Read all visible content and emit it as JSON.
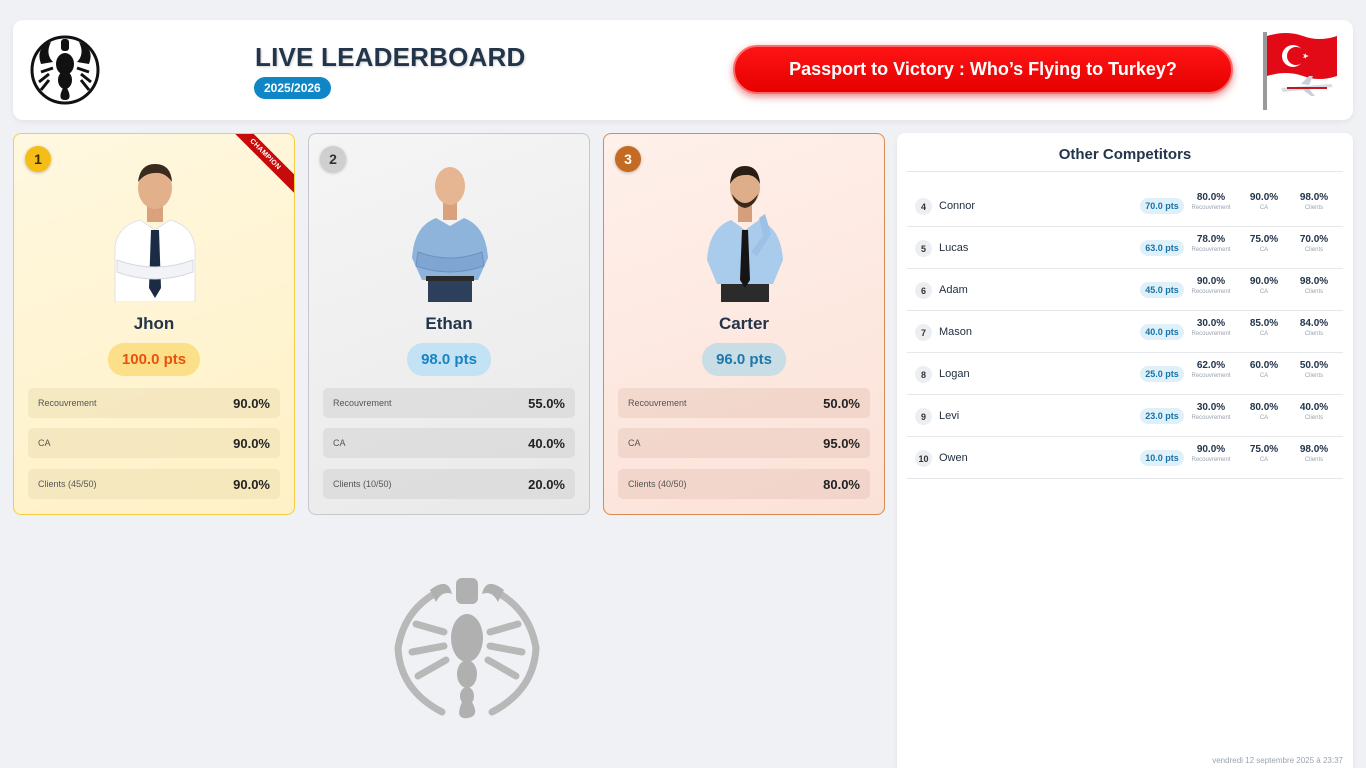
{
  "header": {
    "title": "LIVE LEADERBOARD",
    "season": "2025/2026",
    "promo": "Passport to Victory : Who’s Flying to Turkey?"
  },
  "podium": [
    {
      "rank": "1",
      "name": "Jhon",
      "points": "100.0 pts",
      "ribbon": "CHAMPION",
      "metrics": [
        {
          "label": "Recouvrement",
          "value": "90.0%"
        },
        {
          "label": "CA",
          "value": "90.0%"
        },
        {
          "label": "Clients (45/50)",
          "value": "90.0%"
        }
      ]
    },
    {
      "rank": "2",
      "name": "Ethan",
      "points": "98.0 pts",
      "metrics": [
        {
          "label": "Recouvrement",
          "value": "55.0%"
        },
        {
          "label": "CA",
          "value": "40.0%"
        },
        {
          "label": "Clients (10/50)",
          "value": "20.0%"
        }
      ]
    },
    {
      "rank": "3",
      "name": "Carter",
      "points": "96.0 pts",
      "metrics": [
        {
          "label": "Recouvrement",
          "value": "50.0%"
        },
        {
          "label": "CA",
          "value": "95.0%"
        },
        {
          "label": "Clients (40/50)",
          "value": "80.0%"
        }
      ]
    }
  ],
  "panel": {
    "title": "Other Competitors",
    "stat_labels": [
      "Recouvrement",
      "CA",
      "Clients"
    ],
    "rows": [
      {
        "rank": "4",
        "name": "Connor",
        "points": "70.0 pts",
        "stats": [
          "80.0%",
          "90.0%",
          "98.0%"
        ]
      },
      {
        "rank": "5",
        "name": "Lucas",
        "points": "63.0 pts",
        "stats": [
          "78.0%",
          "75.0%",
          "70.0%"
        ]
      },
      {
        "rank": "6",
        "name": "Adam",
        "points": "45.0 pts",
        "stats": [
          "90.0%",
          "90.0%",
          "98.0%"
        ]
      },
      {
        "rank": "7",
        "name": "Mason",
        "points": "40.0 pts",
        "stats": [
          "30.0%",
          "85.0%",
          "84.0%"
        ]
      },
      {
        "rank": "8",
        "name": "Logan",
        "points": "25.0 pts",
        "stats": [
          "62.0%",
          "60.0%",
          "50.0%"
        ]
      },
      {
        "rank": "9",
        "name": "Levi",
        "points": "23.0 pts",
        "stats": [
          "30.0%",
          "80.0%",
          "40.0%"
        ]
      },
      {
        "rank": "10",
        "name": "Owen",
        "points": "10.0 pts",
        "stats": [
          "90.0%",
          "75.0%",
          "98.0%"
        ]
      }
    ],
    "timestamp": "vendredi 12 septembre 2025 à 23:37"
  },
  "icons": {
    "logo": "scorpion-logo-icon",
    "flag": "turkey-flag-icon",
    "watermark": "scorpion-watermark-icon"
  },
  "colors": {
    "accent_blue": "#0f86c6",
    "promo_red": "#ff1414",
    "gold": "#f4be16",
    "silver": "#cfcfcf",
    "bronze": "#c46a22"
  }
}
